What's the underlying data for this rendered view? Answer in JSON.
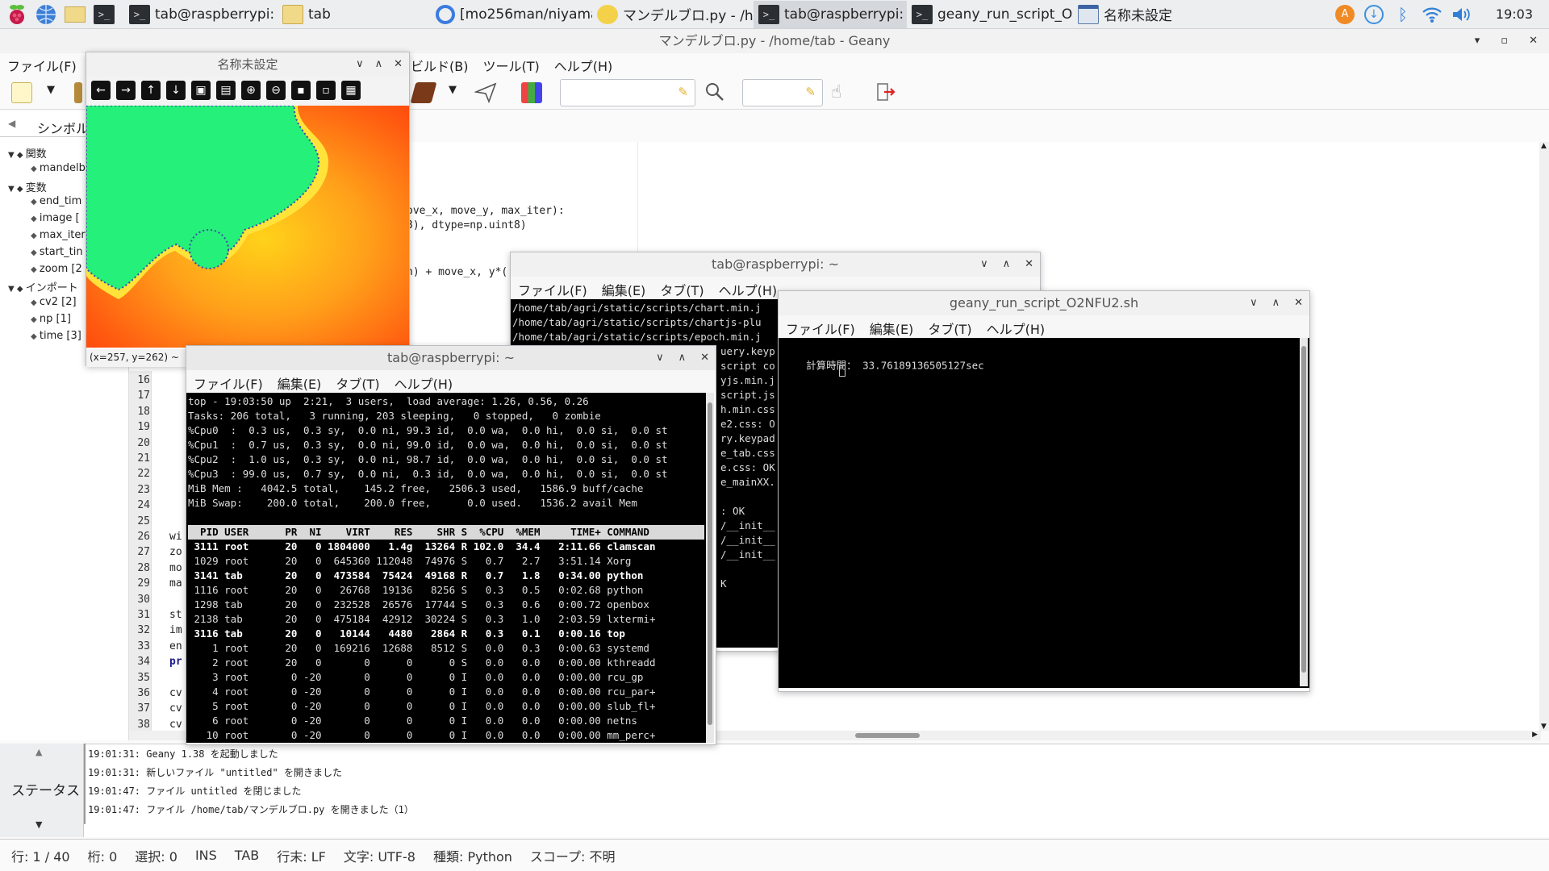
{
  "taskbar": {
    "tasks": [
      {
        "label": "tab@raspberrypi: ~",
        "icon": "terminal-icon"
      },
      {
        "label": "tab",
        "icon": "folder-icon"
      },
      {
        "label": "[mo256man/niyama ...",
        "icon": "chromium-icon"
      },
      {
        "label": "マンデルブロ.py - /h...",
        "icon": "geany-icon"
      },
      {
        "label": "tab@raspberrypi: ~",
        "icon": "terminal-icon"
      },
      {
        "label": "geany_run_script_O2...",
        "icon": "terminal-icon"
      },
      {
        "label": "名称未設定",
        "icon": "window-icon"
      }
    ],
    "clock": "19:03"
  },
  "geany": {
    "title": "マンデルブロ.py - /home/tab - Geany",
    "menu": [
      "ファイル(F)",
      "ビルド(B)",
      "ツール(T)",
      "ヘルプ(H)"
    ],
    "sidebar_tab": "シンボル",
    "tree": [
      {
        "label": "関数",
        "level": 0
      },
      {
        "label": "mandelb",
        "level": 1
      },
      {
        "label": "変数",
        "level": 0
      },
      {
        "label": "end_tim",
        "level": 1
      },
      {
        "label": "image [",
        "level": 1
      },
      {
        "label": "max_iter",
        "level": 1
      },
      {
        "label": "start_tin",
        "level": 1
      },
      {
        "label": "zoom [2",
        "level": 1
      },
      {
        "label": "インポート",
        "level": 0
      },
      {
        "label": "cv2 [2]",
        "level": 1
      },
      {
        "label": "np [1]",
        "level": 1
      },
      {
        "label": "time [3]",
        "level": 1
      }
    ],
    "code_fragments": [
      "ove_x, move_y, max_iter):",
      "3), dtype=np.uint8)",
      "n) + move_x, y*("
    ],
    "line_numbers": [
      "16",
      "17",
      "18",
      "19",
      "20",
      "21",
      "22",
      "23",
      "24",
      "25",
      "26",
      "27",
      "28",
      "29",
      "30",
      "31",
      "32",
      "33",
      "34",
      "35",
      "36",
      "37",
      "38"
    ],
    "left_code": {
      "26": "wi",
      "27": "zo",
      "28": "mo",
      "29": "ma",
      "31": "st",
      "32": "im",
      "33": "en",
      "34": "pr",
      "36": "cv",
      "37": "cv",
      "38": "cv"
    },
    "messages_tab": "ステータス",
    "messages": [
      "19:01:31: Geany 1.38 を起動しました",
      "19:01:31: 新しいファイル \"untitled\" を開きました",
      "19:01:47: ファイル untitled を閉じました",
      "19:01:47: ファイル /home/tab/マンデルブロ.py を開きました（1）"
    ],
    "status": [
      "行: 1 / 40",
      "桁: 0",
      "選択: 0",
      "INS",
      "TAB",
      "行末: LF",
      "文字: UTF-8",
      "種類: Python",
      "スコープ: 不明"
    ]
  },
  "image_window": {
    "title": "名称未設定",
    "status": "(x=257, y=262) ~"
  },
  "term1": {
    "title": "tab@raspberrypi: ~",
    "menu": [
      "ファイル(F)",
      "編集(E)",
      "タブ(T)",
      "ヘルプ(H)"
    ],
    "lines": [
      "/home/tab/agri/static/scripts/chart.min.j",
      "/home/tab/agri/static/scripts/chartjs-plu",
      "/home/tab/agri/static/scripts/epoch.min.j",
      "uery.keyp",
      "script co",
      "yjs.min.j",
      "script.js",
      "h.min.css",
      "e2.css: O",
      "ry.keypad",
      "e_tab.css",
      "e.css: OK",
      "e_mainXX.",
      "",
      ": OK",
      "/__init__",
      "/__init__",
      "/__init__",
      "",
      "K"
    ]
  },
  "term2": {
    "title": "geany_run_script_O2NFU2.sh",
    "menu": [
      "ファイル(F)",
      "編集(E)",
      "タブ(T)",
      "ヘルプ(H)"
    ],
    "output": "計算時間： 33.76189136505127sec"
  },
  "top": {
    "title": "tab@raspberrypi: ~",
    "menu": [
      "ファイル(F)",
      "編集(E)",
      "タブ(T)",
      "ヘルプ(H)"
    ],
    "summary": [
      "top - 19:03:50 up  2:21,  3 users,  load average: 1.26, 0.56, 0.26",
      "Tasks: 206 total,   3 running, 203 sleeping,   0 stopped,   0 zombie",
      "%Cpu0  :  0.3 us,  0.3 sy,  0.0 ni, 99.3 id,  0.0 wa,  0.0 hi,  0.0 si,  0.0 st",
      "%Cpu1  :  0.7 us,  0.3 sy,  0.0 ni, 99.0 id,  0.0 wa,  0.0 hi,  0.0 si,  0.0 st",
      "%Cpu2  :  1.0 us,  0.3 sy,  0.0 ni, 98.7 id,  0.0 wa,  0.0 hi,  0.0 si,  0.0 st",
      "%Cpu3  : 99.0 us,  0.7 sy,  0.0 ni,  0.3 id,  0.0 wa,  0.0 hi,  0.0 si,  0.0 st",
      "MiB Mem :   4042.5 total,    145.2 free,   2506.3 used,   1586.9 buff/cache",
      "MiB Swap:    200.0 total,    200.0 free,      0.0 used.   1536.2 avail Mem"
    ],
    "header": "  PID USER      PR  NI    VIRT    RES    SHR S  %CPU  %MEM     TIME+ COMMAND",
    "rows": [
      {
        "text": " 3111 root      20   0 1804000   1.4g  13264 R 102.0  34.4   2:11.66 clamscan",
        "bold": true
      },
      {
        "text": " 1029 root      20   0  645360 112048  74976 S   0.7   2.7   3:51.14 Xorg",
        "bold": false
      },
      {
        "text": " 3141 tab       20   0  473584  75424  49168 R   0.7   1.8   0:34.00 python",
        "bold": true
      },
      {
        "text": " 1116 root      20   0   26768  19136   8256 S   0.3   0.5   0:02.68 python",
        "bold": false
      },
      {
        "text": " 1298 tab       20   0  232528  26576  17744 S   0.3   0.6   0:00.72 openbox",
        "bold": false
      },
      {
        "text": " 2138 tab       20   0  475184  42912  30224 S   0.3   1.0   2:03.59 lxtermi+",
        "bold": false
      },
      {
        "text": " 3116 tab       20   0   10144   4480   2864 R   0.3   0.1   0:00.16 top",
        "bold": true
      },
      {
        "text": "    1 root      20   0  169216  12688   8512 S   0.0   0.3   0:00.63 systemd",
        "bold": false
      },
      {
        "text": "    2 root      20   0       0      0      0 S   0.0   0.0   0:00.00 kthreadd",
        "bold": false
      },
      {
        "text": "    3 root       0 -20       0      0      0 I   0.0   0.0   0:00.00 rcu_gp",
        "bold": false
      },
      {
        "text": "    4 root       0 -20       0      0      0 I   0.0   0.0   0:00.00 rcu_par+",
        "bold": false
      },
      {
        "text": "    5 root       0 -20       0      0      0 I   0.0   0.0   0:00.00 slub_fl+",
        "bold": false
      },
      {
        "text": "    6 root       0 -20       0      0      0 I   0.0   0.0   0:00.00 netns",
        "bold": false
      },
      {
        "text": "   10 root       0 -20       0      0      0 I   0.0   0.0   0:00.00 mm_perc+",
        "bold": false
      }
    ]
  }
}
